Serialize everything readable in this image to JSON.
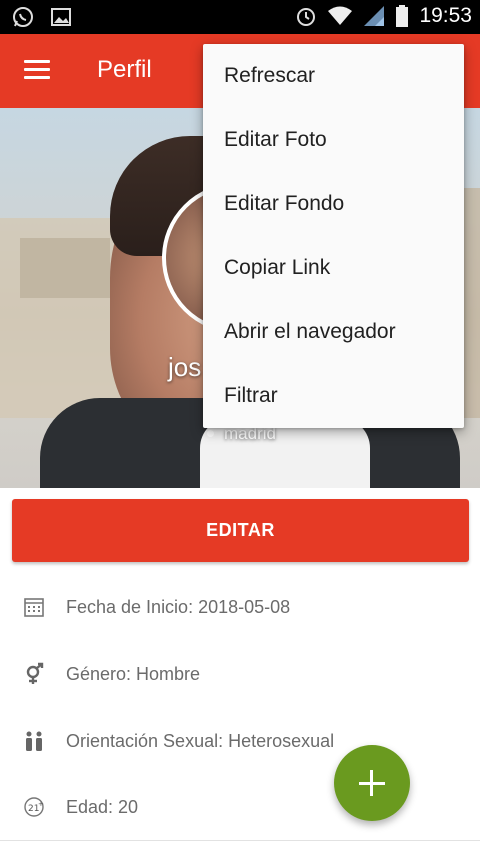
{
  "status_bar": {
    "time": "19:53",
    "left_icons": [
      "whatsapp-icon",
      "image-icon"
    ],
    "right_icons": [
      "alarm-icon",
      "wifi-icon",
      "signal-icon",
      "battery-icon"
    ]
  },
  "toolbar": {
    "title": "Perfil",
    "menu_icon": "hamburger-icon",
    "color": "#e53a25"
  },
  "cover": {
    "name": "jos",
    "city": "madrid"
  },
  "edit_button": {
    "label": "EDITAR"
  },
  "info": [
    {
      "icon": "calendar-icon",
      "text": "Fecha de Inicio: 2018-05-08"
    },
    {
      "icon": "gender-icon",
      "text": "Género: Hombre"
    },
    {
      "icon": "people-icon",
      "text": "Orientación Sexual: Heterosexual"
    },
    {
      "icon": "age-21-icon",
      "text": "Edad: 20"
    }
  ],
  "fab": {
    "icon": "plus-icon",
    "color": "#6a9a1f"
  },
  "overflow_menu": {
    "items": [
      "Refrescar",
      "Editar Foto",
      "Editar Fondo",
      "Copiar Link",
      "Abrir el navegador",
      "Filtrar"
    ]
  }
}
